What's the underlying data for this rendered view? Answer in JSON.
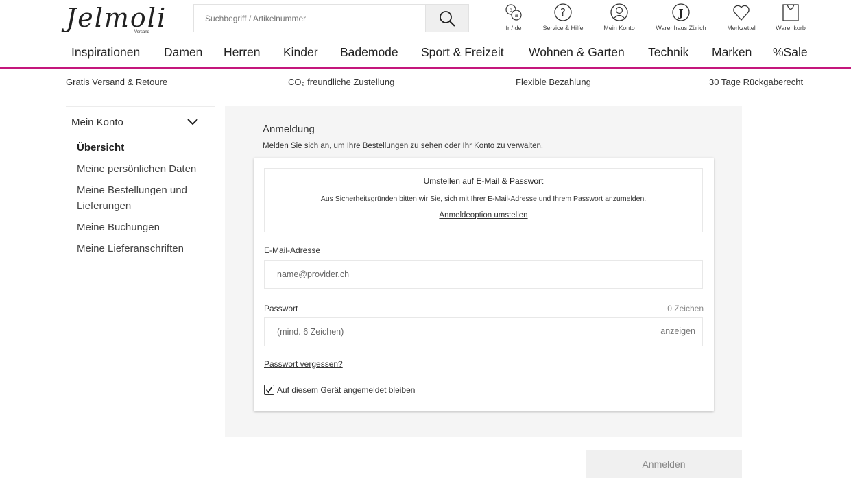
{
  "header": {
    "logo": "Jelmoli",
    "logo_sub": "Versand",
    "search_placeholder": "Suchbegriff / Artikelnummer",
    "icons": [
      {
        "label": "fr / de",
        "icon": "language-icon"
      },
      {
        "label": "Service & Hilfe",
        "icon": "help-icon"
      },
      {
        "label": "Mein Konto",
        "icon": "account-icon"
      },
      {
        "label": "Warenhaus Zürich",
        "icon": "store-icon"
      },
      {
        "label": "Merkzettel",
        "icon": "heart-icon"
      },
      {
        "label": "Warenkorb",
        "icon": "bag-icon"
      }
    ]
  },
  "nav": [
    "Inspirationen",
    "Damen",
    "Herren",
    "Kinder",
    "Bademode",
    "Sport & Freizeit",
    "Wohnen & Garten",
    "Technik",
    "Marken",
    "%Sale"
  ],
  "usp": [
    "Gratis Versand & Retoure",
    "CO₂ freundliche Zustellung",
    "Flexible Bezahlung",
    "30 Tage Rückgaberecht"
  ],
  "sidebar": {
    "title": "Mein Konto",
    "items": [
      "Übersicht",
      "Meine persönlichen Daten",
      "Meine Bestellungen und Lieferungen",
      "Meine Buchungen",
      "Meine Lieferanschriften"
    ]
  },
  "login": {
    "title": "Anmeldung",
    "subtitle": "Melden Sie sich an, um Ihre Bestellungen zu sehen oder Ihr Konto zu verwalten.",
    "notice_title": "Umstellen auf E-Mail & Passwort",
    "notice_text": "Aus Sicherheitsgründen bitten wir Sie, sich mit Ihrer E-Mail-Adresse und Ihrem Passwort anzumelden.",
    "notice_link": "Anmeldeoption umstellen",
    "email_label": "E-Mail-Adresse",
    "email_placeholder": "name@provider.ch",
    "password_label": "Passwort",
    "password_count": "0 Zeichen",
    "password_placeholder": "(mind. 6 Zeichen)",
    "show_label": "anzeigen",
    "forgot_label": "Passwort vergessen?",
    "remember_label": "Auf diesem Gerät angemeldet bleiben",
    "remember_checked": true,
    "submit_label": "Anmelden"
  },
  "colors": {
    "accent": "#c4177c"
  }
}
